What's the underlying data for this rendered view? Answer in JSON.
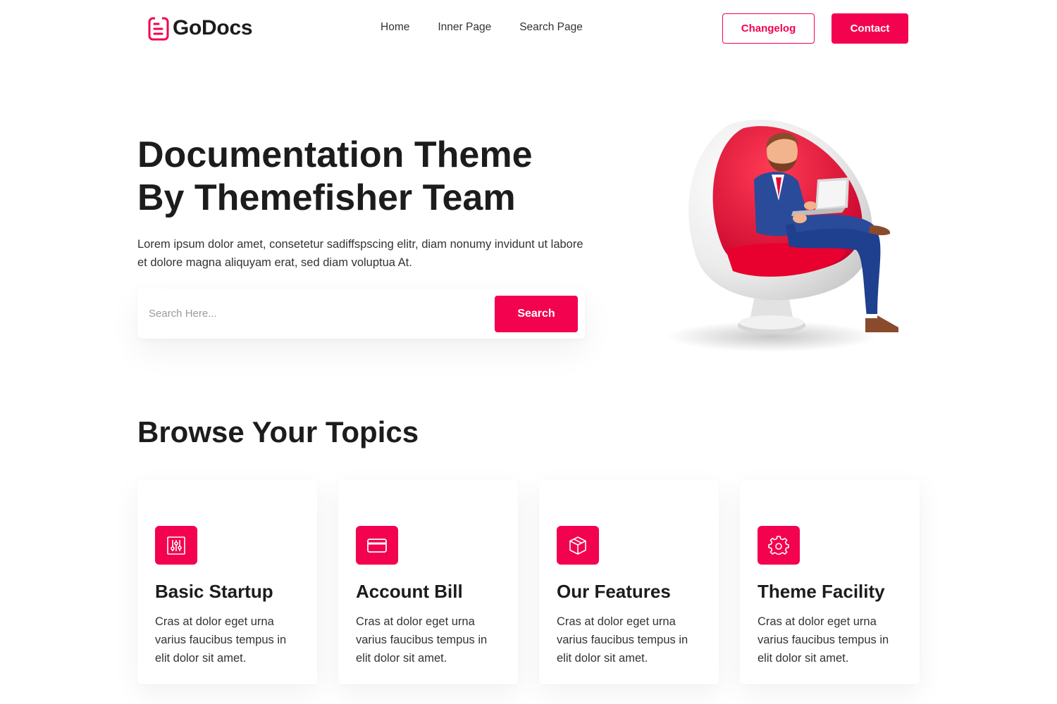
{
  "header": {
    "logo_text": "GoDocs",
    "nav": [
      "Home",
      "Inner Page",
      "Search Page"
    ],
    "changelog_label": "Changelog",
    "contact_label": "Contact"
  },
  "hero": {
    "title": "Documentation Theme\nBy Themefisher Team",
    "description": "Lorem ipsum dolor amet, consetetur sadiffspscing elitr, diam nonumy invidunt ut labore et dolore magna aliquyam erat, sed diam voluptua At.",
    "search_placeholder": "Search Here...",
    "search_button": "Search"
  },
  "topics": {
    "title": "Browse Your Topics",
    "cards": [
      {
        "title": "Basic Startup",
        "description": "Cras at dolor eget urna varius faucibus tempus in elit dolor sit amet.",
        "icon": "sliders-icon"
      },
      {
        "title": "Account Bill",
        "description": "Cras at dolor eget urna varius faucibus tempus in elit dolor sit amet.",
        "icon": "credit-card-icon"
      },
      {
        "title": "Our Features",
        "description": "Cras at dolor eget urna varius faucibus tempus in elit dolor sit amet.",
        "icon": "box-icon"
      },
      {
        "title": "Theme Facility",
        "description": "Cras at dolor eget urna varius faucibus tempus in elit dolor sit amet.",
        "icon": "gear-icon"
      }
    ]
  },
  "colors": {
    "accent": "#f3034f",
    "text": "#1c1c1c"
  }
}
